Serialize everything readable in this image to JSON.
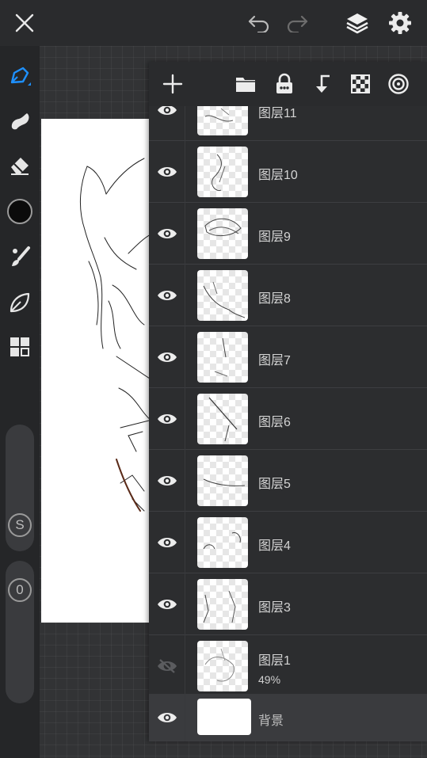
{
  "topbar": {
    "close": "close-icon",
    "undo": "undo-icon",
    "redo": "redo-icon",
    "layers": "layers-icon",
    "settings": "gear-icon"
  },
  "leftbar": {
    "tools": [
      "pen-icon",
      "smudge-icon",
      "eraser-icon",
      "color-swatch",
      "brush-icon",
      "leaf-icon",
      "grid-icon"
    ],
    "color_swatch": "#0b0b0b",
    "accent": "#1e90ff",
    "size_label": "S",
    "opacity_label": "0"
  },
  "layer_panel": {
    "toolbar": [
      "add-icon",
      "folder-icon",
      "lock-icon",
      "merge-down-icon",
      "checker-icon",
      "target-icon"
    ],
    "layers": [
      {
        "name": "图层11",
        "visible": true
      },
      {
        "name": "图层10",
        "visible": true
      },
      {
        "name": "图层9",
        "visible": true
      },
      {
        "name": "图层8",
        "visible": true
      },
      {
        "name": "图层7",
        "visible": true
      },
      {
        "name": "图层6",
        "visible": true
      },
      {
        "name": "图层5",
        "visible": true
      },
      {
        "name": "图层4",
        "visible": true
      },
      {
        "name": "图层3",
        "visible": true
      },
      {
        "name": "图层1",
        "visible": false,
        "opacity": "49%"
      },
      {
        "name": "背景",
        "visible": true
      }
    ]
  }
}
